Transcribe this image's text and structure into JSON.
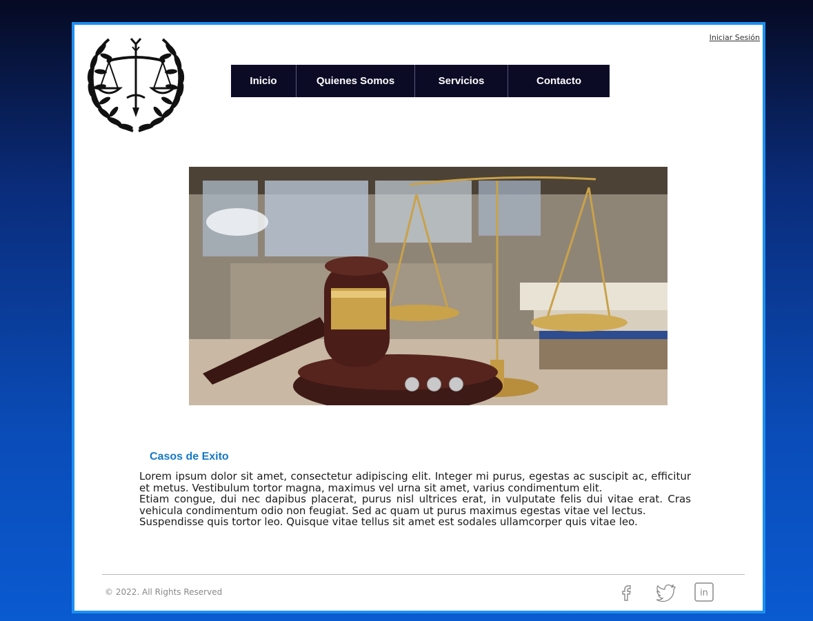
{
  "header": {
    "login_link": "Iniciar Sesión"
  },
  "nav": {
    "items": [
      {
        "label": "Inicio"
      },
      {
        "label": "Quienes Somos"
      },
      {
        "label": "Servicios"
      },
      {
        "label": "Contacto"
      }
    ]
  },
  "carousel": {
    "slide_count": 3,
    "active_index": 0
  },
  "section": {
    "title": "Casos de Exito",
    "paragraphs": [
      "Lorem ipsum dolor sit amet, consectetur adipiscing elit. Integer mi purus, egestas ac suscipit ac, efficitur et metus. Vestibulum tortor magna, maximus vel urna sit amet, varius condimentum elit.",
      "Etiam congue, dui nec dapibus placerat, purus nisl ultrices erat, in vulputate felis dui vitae erat. Cras vehicula condimentum odio non feugiat. Sed ac quam ut purus maximus egestas vitae vel lectus.",
      "Suspendisse quis tortor leo. Quisque vitae tellus sit amet est sodales ullamcorper quis vitae leo."
    ]
  },
  "footer": {
    "copyright": "© 2022. All Rights Reserved",
    "social": [
      {
        "icon": "facebook-icon"
      },
      {
        "icon": "twitter-icon"
      },
      {
        "icon": "linkedin-icon"
      }
    ]
  },
  "colors": {
    "nav_background": "#0b0b26",
    "frame_border": "#1d8ff0",
    "section_title": "#1579c6"
  }
}
